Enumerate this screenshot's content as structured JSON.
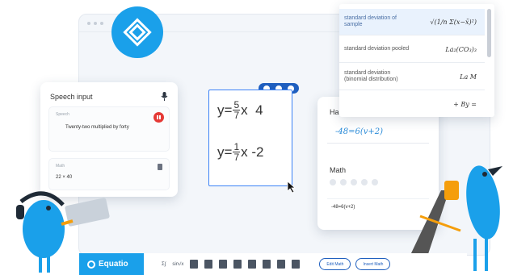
{
  "speech_panel": {
    "title": "Speech input",
    "speech_label": "Speech",
    "speech_text": "Twenty-two multiplied by forty",
    "math_label": "Math",
    "math_value": "22 × 40"
  },
  "editor": {
    "eq1": {
      "lhs": "y=",
      "num": "5",
      "den": "7",
      "rest": "x  4"
    },
    "eq2": {
      "lhs": "y=",
      "num": "1",
      "den": "7",
      "rest": "x -2"
    }
  },
  "handwriting": {
    "title": "Handwriting",
    "ink": "-48=6(v+2)",
    "math_label": "Math",
    "result": "-48=6(v+2)"
  },
  "prediction": {
    "items": [
      {
        "label": "standard deviation of sample",
        "formula": "√(1/n Σ(x−x̄)²)"
      },
      {
        "label": "standard deviation pooled",
        "formula": "La₂(CO₃)₃"
      },
      {
        "label": "standard deviation (binomial distribution)",
        "formula": "La M"
      },
      {
        "label": "",
        "formula": "+ By ="
      }
    ]
  },
  "toolbar": {
    "brand": "Equatio",
    "icon_text_1": "Σ∫",
    "icon_text_2": "sin√x",
    "edit_math": "Edit Math",
    "insert_math": "Insert Math"
  },
  "colors": {
    "brand": "#1aa0ea",
    "accent": "#1f5fbf",
    "record": "#e53935"
  }
}
